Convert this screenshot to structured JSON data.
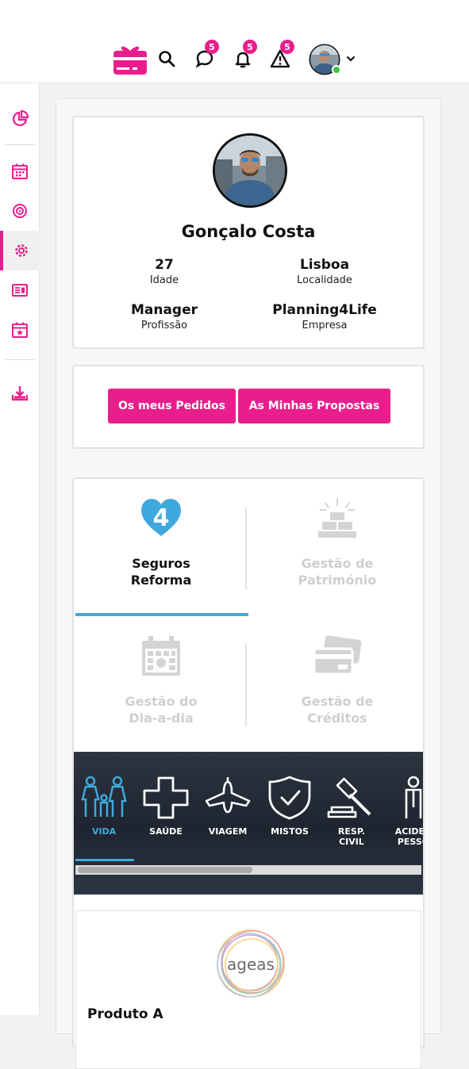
{
  "header": {
    "notifications": [
      {
        "name": "messages",
        "count": "5"
      },
      {
        "name": "alerts",
        "count": "5"
      },
      {
        "name": "warnings",
        "count": "5"
      }
    ]
  },
  "profile": {
    "name": "Gonçalo Costa",
    "age_value": "27",
    "age_label": "Idade",
    "location_value": "Lisboa",
    "location_label": "Localidade",
    "job_value": "Manager",
    "job_label": "Profissão",
    "company_value": "Planning4Life",
    "company_label": "Empresa"
  },
  "actions": {
    "orders": "Os meus Pedidos",
    "proposals": "As Minhas Propostas"
  },
  "categories": [
    {
      "line1": "Seguros",
      "line2": "Reforma",
      "active": true
    },
    {
      "line1": "Gestão de",
      "line2": "Património",
      "active": false
    },
    {
      "line1": "Gestão do",
      "line2": "Dia-a-dia",
      "active": false
    },
    {
      "line1": "Gestão de",
      "line2": "Créditos",
      "active": false
    }
  ],
  "insurance_types": [
    {
      "label": "VIDA",
      "active": true
    },
    {
      "label": "SAÚDE"
    },
    {
      "label": "VIAGEM"
    },
    {
      "label": "MISTOS"
    },
    {
      "label": "RESP.",
      "label2": "CIVIL"
    },
    {
      "label": "ACIDEN",
      "label2": "PESSO"
    }
  ],
  "product": {
    "brand": "ageas",
    "name": "Produto A"
  },
  "colors": {
    "accent": "#e91e8c",
    "active_tab": "#3fa9dd",
    "online": "#3cc43c"
  }
}
